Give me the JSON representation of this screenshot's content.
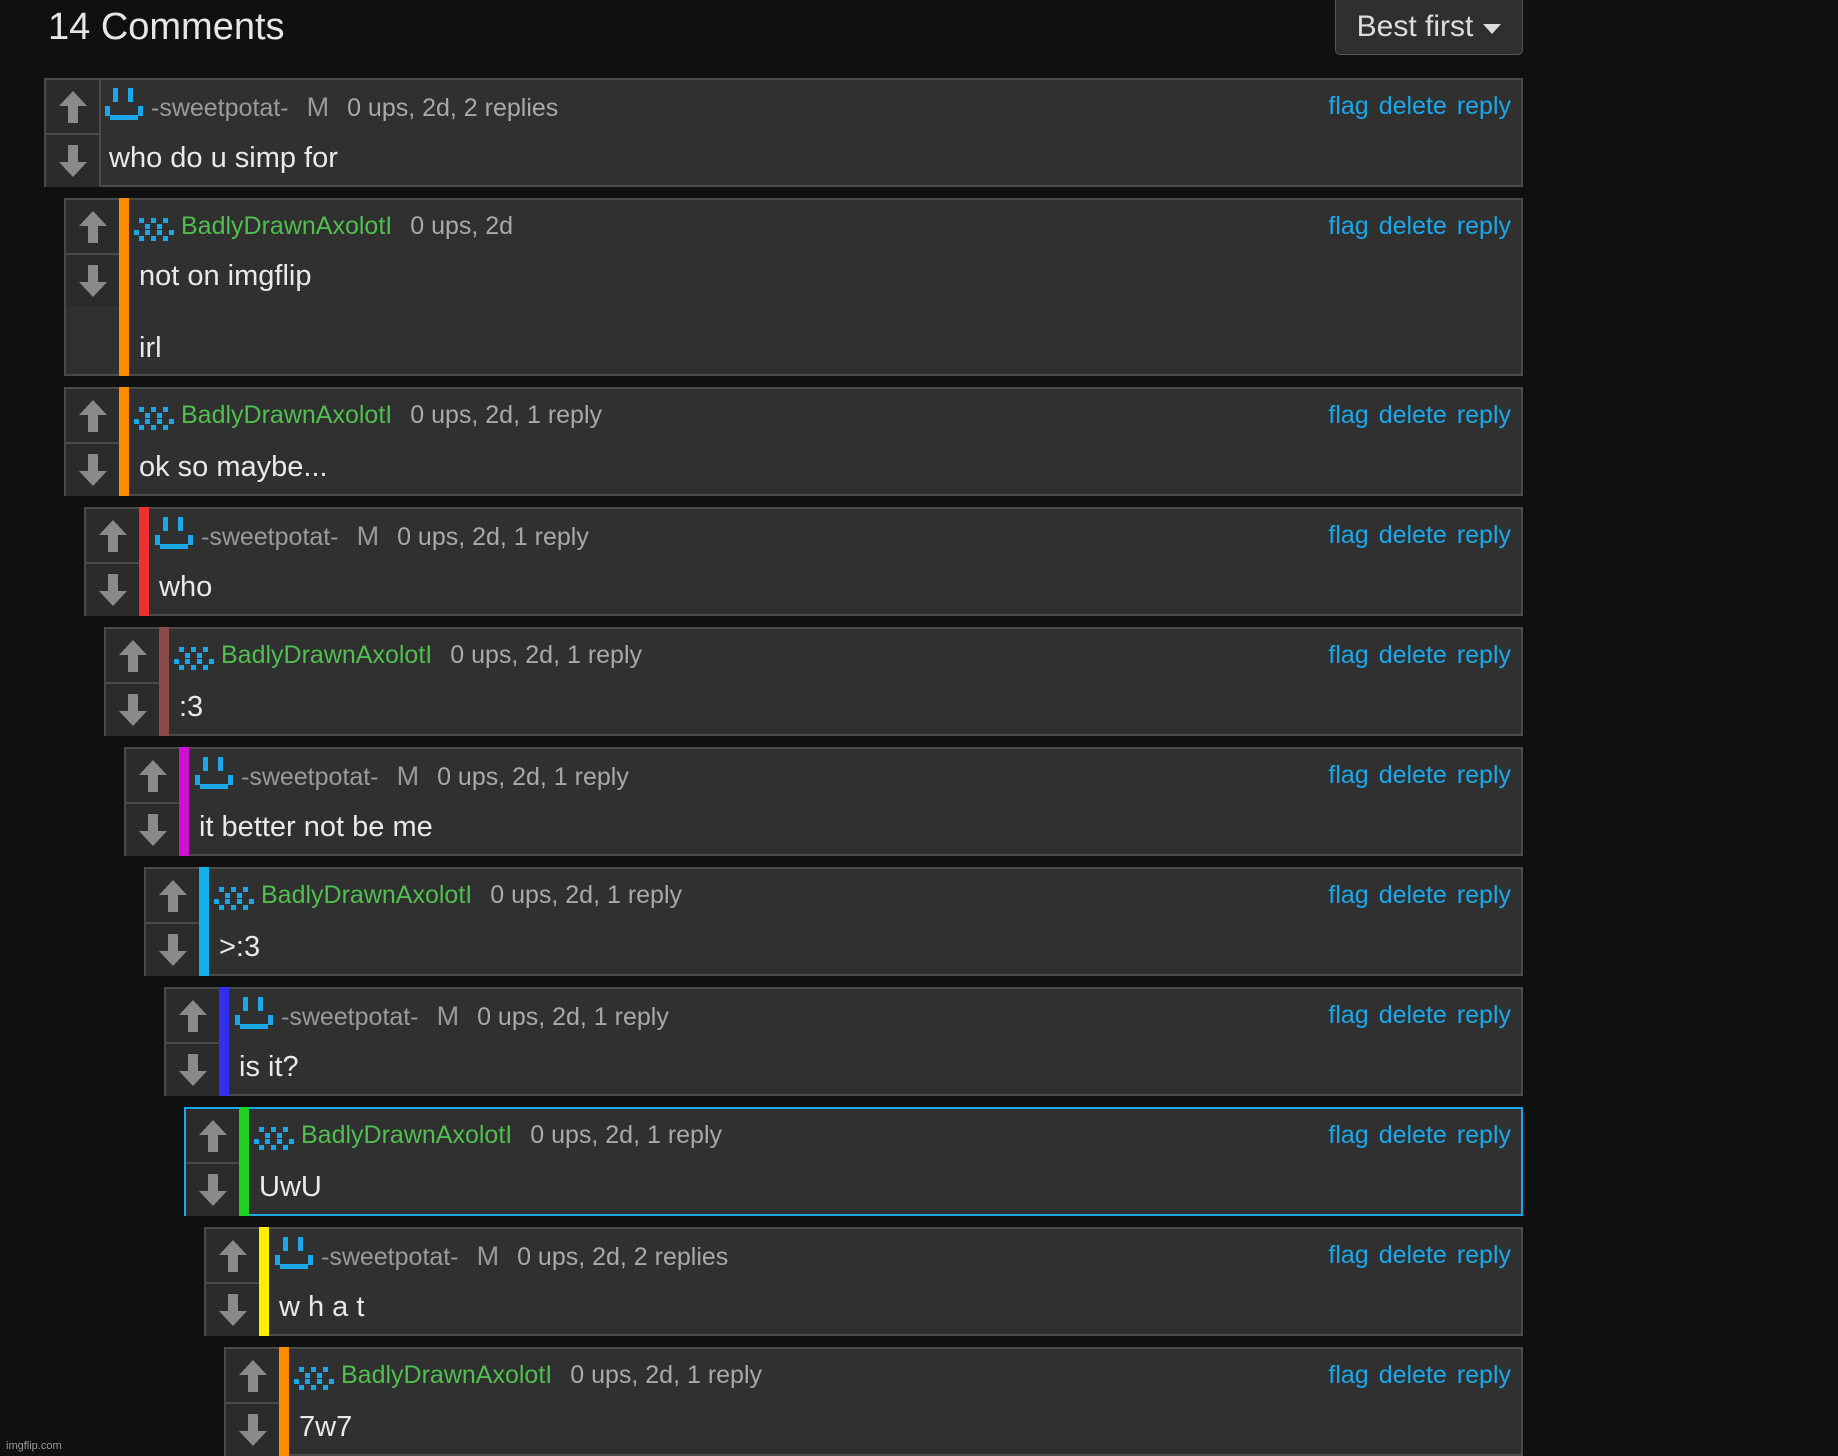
{
  "header": {
    "comment_count": "14 Comments",
    "sort_label": "Best first"
  },
  "actions": {
    "flag": "flag",
    "delete": "delete",
    "reply": "reply"
  },
  "colors": {
    "link": "#1ba8ea",
    "green_user": "#4fbf4f",
    "selected_border": "#1ba8ea"
  },
  "comments": [
    {
      "username": "-sweetpotat-",
      "badge": "M",
      "stats": "0 ups, 2d, 2 replies",
      "text": "who do u simp for",
      "avatar": "smile-avatar",
      "depth": 0,
      "stripe": ""
    },
    {
      "username": "BadlyDrawnAxolotI",
      "badge": "",
      "stats": "0 ups, 2d",
      "text": "not on imgflip\nirl",
      "avatar": "axolotl-avatar",
      "depth": 1,
      "stripe": "#ff8a00"
    },
    {
      "username": "BadlyDrawnAxolotI",
      "badge": "",
      "stats": "0 ups, 2d, 1 reply",
      "text": "ok so maybe...",
      "avatar": "axolotl-avatar",
      "depth": 1,
      "stripe": "#ff8a00"
    },
    {
      "username": "-sweetpotat-",
      "badge": "M",
      "stats": "0 ups, 2d, 1 reply",
      "text": "who",
      "avatar": "smile-avatar",
      "depth": 2,
      "stripe": "#ee3030"
    },
    {
      "username": "BadlyDrawnAxolotI",
      "badge": "",
      "stats": "0 ups, 2d, 1 reply",
      "text": ":3",
      "avatar": "axolotl-avatar",
      "depth": 3,
      "stripe": "#8a4a4a"
    },
    {
      "username": "-sweetpotat-",
      "badge": "M",
      "stats": "0 ups, 2d, 1 reply",
      "text": "it better not be me",
      "avatar": "smile-avatar",
      "depth": 4,
      "stripe": "#d010d0"
    },
    {
      "username": "BadlyDrawnAxolotI",
      "badge": "",
      "stats": "0 ups, 2d, 1 reply",
      "text": ">:3",
      "avatar": "axolotl-avatar",
      "depth": 5,
      "stripe": "#10b0ea"
    },
    {
      "username": "-sweetpotat-",
      "badge": "M",
      "stats": "0 ups, 2d, 1 reply",
      "text": "is it?",
      "avatar": "smile-avatar",
      "depth": 6,
      "stripe": "#3030ee"
    },
    {
      "username": "BadlyDrawnAxolotI",
      "badge": "",
      "stats": "0 ups, 2d, 1 reply",
      "text": "UwU",
      "avatar": "axolotl-avatar",
      "depth": 7,
      "stripe": "#20d020",
      "selected": true
    },
    {
      "username": "-sweetpotat-",
      "badge": "M",
      "stats": "0 ups, 2d, 2 replies",
      "text": "w h a t",
      "avatar": "smile-avatar",
      "depth": 8,
      "stripe": "#ffee00"
    },
    {
      "username": "BadlyDrawnAxolotI",
      "badge": "",
      "stats": "0 ups, 2d, 1 reply",
      "text": "7w7",
      "avatar": "axolotl-avatar",
      "depth": 9,
      "stripe": "#ff8a00"
    }
  ],
  "watermark": "imgflip.com"
}
